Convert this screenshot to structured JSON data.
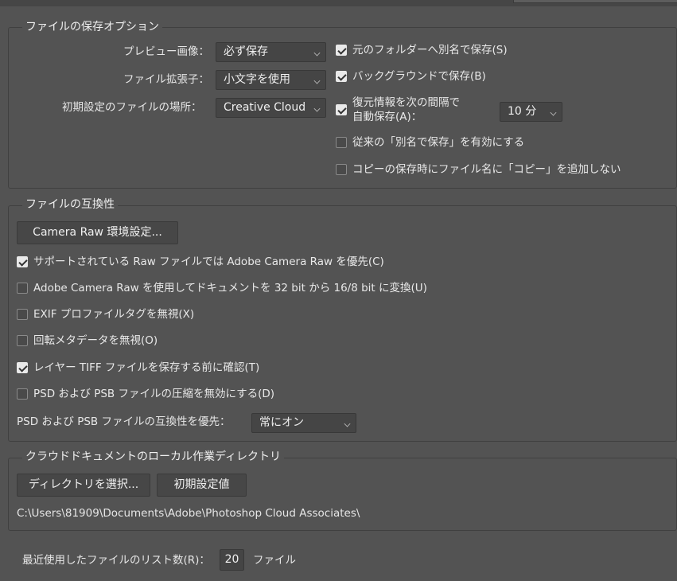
{
  "file_save_options": {
    "title": "ファイルの保存オプション",
    "preview_label": "プレビュー画像：",
    "preview_value": "必ず保存",
    "ext_label": "ファイル拡張子：",
    "ext_value": "小文字を使用",
    "default_location_label": "初期設定のファイルの場所：",
    "default_location_value": "Creative Cloud",
    "save_as_original": {
      "label": "元のフォルダーへ別名で保存(S)",
      "checked": true
    },
    "background_save": {
      "label": "バックグラウンドで保存(B)",
      "checked": true
    },
    "auto_save": {
      "label_line1": "復元情報を次の間隔で",
      "label_line2": "自動保存(A)：",
      "checked": true
    },
    "auto_save_interval": "10 分",
    "legacy_save_as": {
      "label": "従来の「別名で保存」を有効にする",
      "checked": false
    },
    "no_copy_suffix": {
      "label": "コピーの保存時にファイル名に「コピー」を追加しない",
      "checked": false
    }
  },
  "file_compat": {
    "title": "ファイルの互換性",
    "camera_raw_button": "Camera Raw 環境設定...",
    "options": [
      {
        "label": "サポートされている Raw ファイルでは Adobe Camera Raw を優先(C)",
        "checked": true
      },
      {
        "label": "Adobe Camera Raw を使用してドキュメントを 32 bit から 16/8 bit に変換(U)",
        "checked": false
      },
      {
        "label": "EXIF プロファイルタグを無視(X)",
        "checked": false
      },
      {
        "label": "回転メタデータを無視(O)",
        "checked": false
      },
      {
        "label": "レイヤー TIFF ファイルを保存する前に確認(T)",
        "checked": true
      },
      {
        "label": "PSD および PSB ファイルの圧縮を無効にする(D)",
        "checked": false
      }
    ],
    "psd_compat_label": "PSD および PSB ファイルの互換性を優先：",
    "psd_compat_value": "常にオン"
  },
  "cloud_dir": {
    "title": "クラウドドキュメントのローカル作業ディレクトリ",
    "choose_button": "ディレクトリを選択...",
    "default_button": "初期設定値",
    "path": "C:\\Users\\81909\\Documents\\Adobe\\Photoshop Cloud Associates\\"
  },
  "recent_files": {
    "label": "最近使用したファイルのリスト数(R)：",
    "value": "20",
    "unit": "ファイル"
  }
}
